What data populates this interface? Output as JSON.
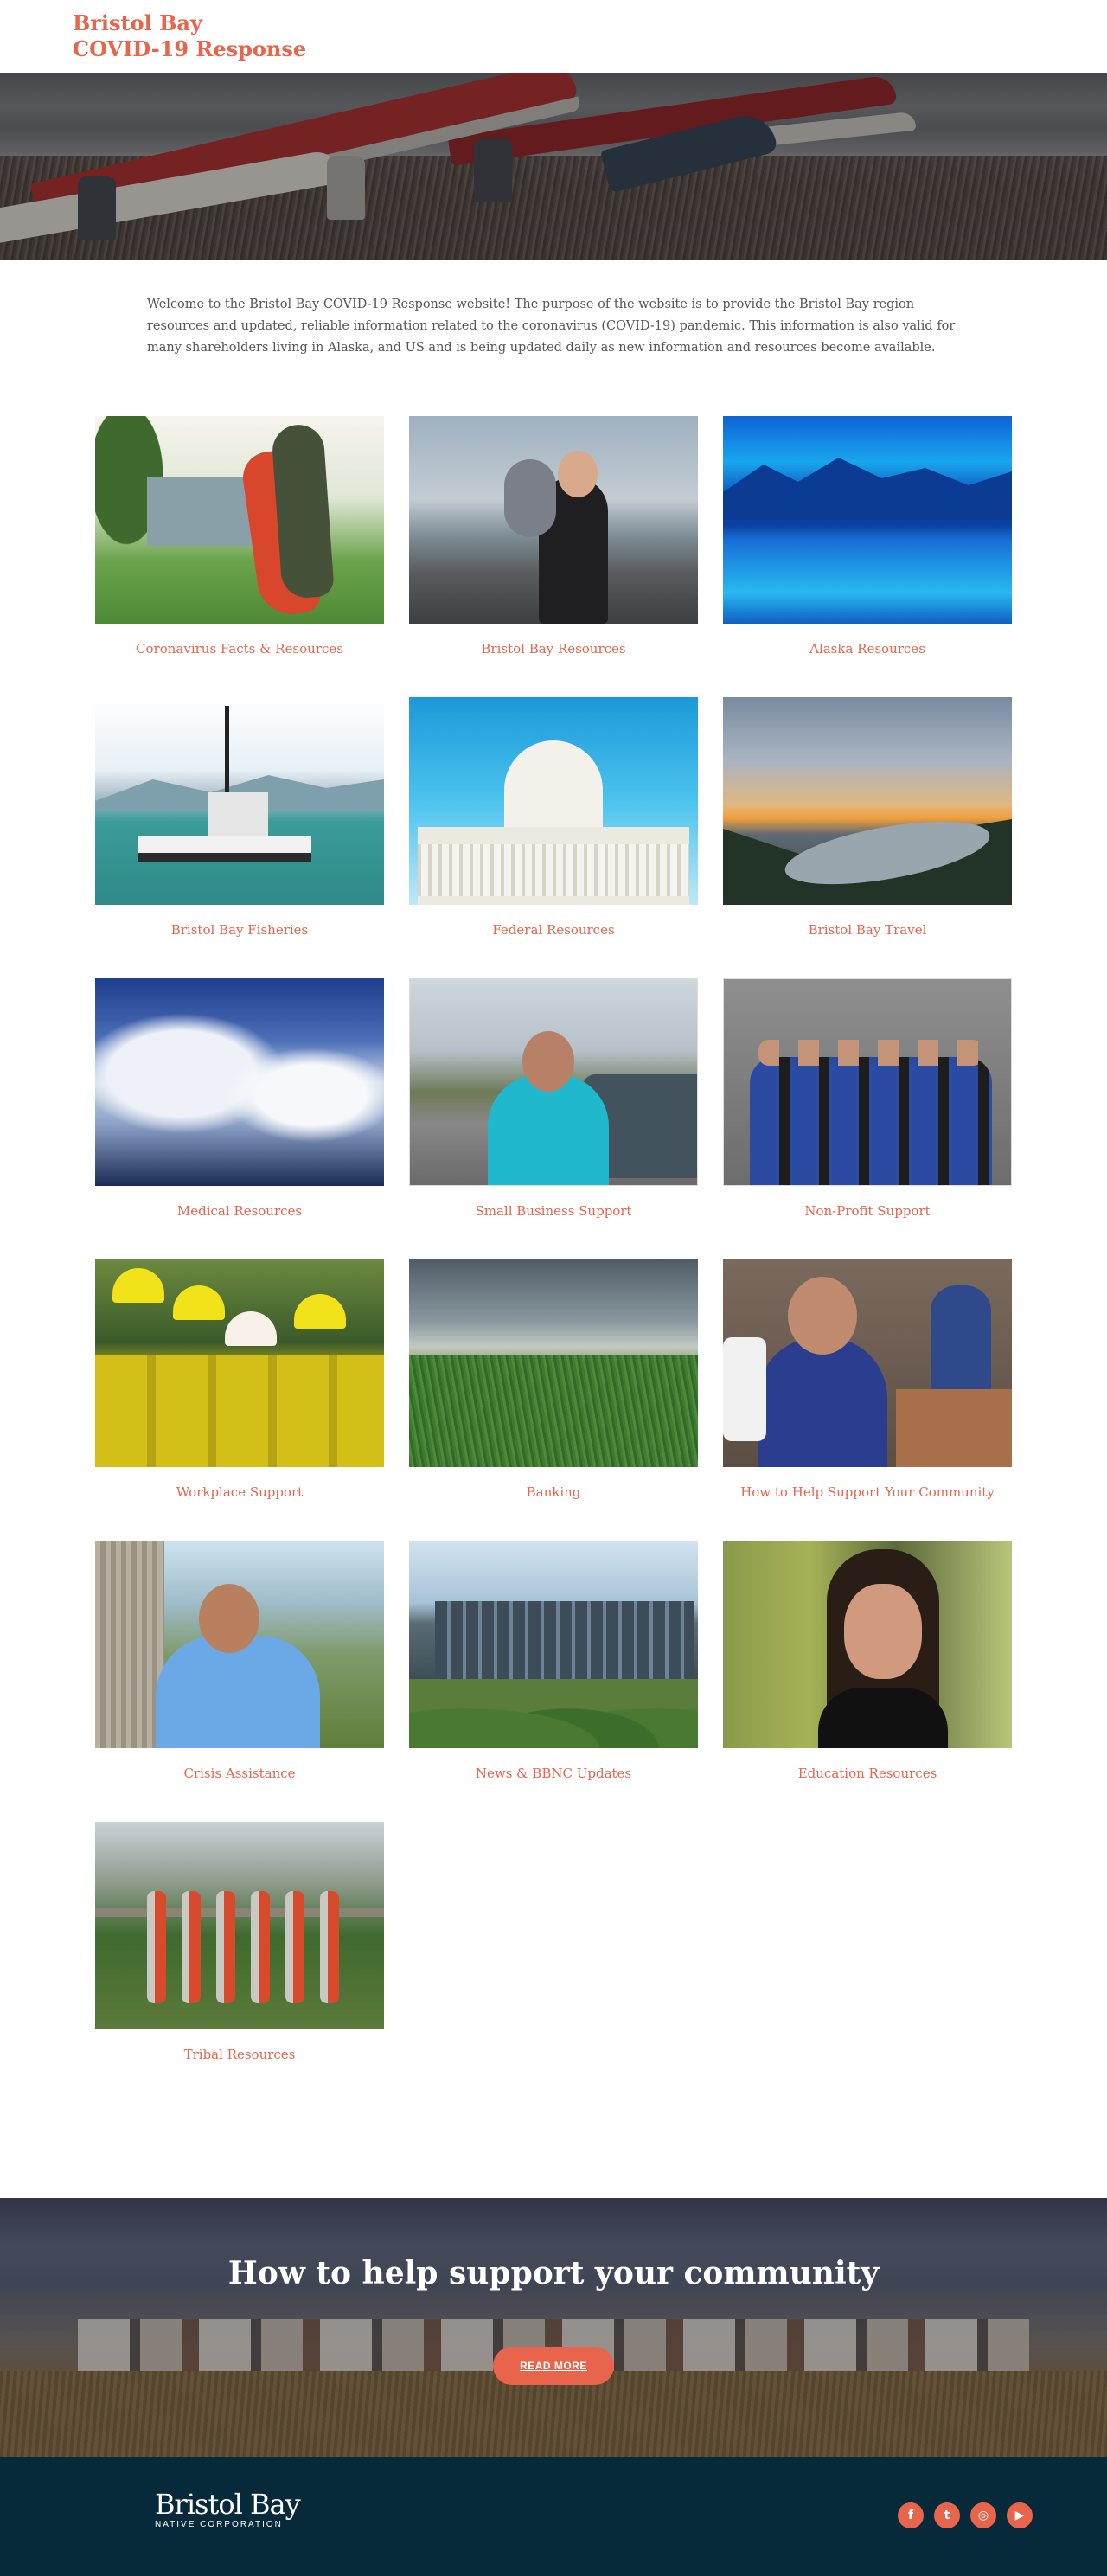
{
  "header": {
    "title_line1": "Bristol Bay",
    "title_line2": "COVID-19 Response"
  },
  "intro": {
    "text": "Welcome to the Bristol Bay COVID-19 Response website! The purpose of the website is to provide the Bristol Bay region resources and updated, reliable information related to the coronavirus (COVID-19) pandemic. This information is also valid for many shareholders living in Alaska, and US and is being updated daily as new information and resources become available."
  },
  "cards": [
    {
      "label": "Coronavirus Facts & Resources"
    },
    {
      "label": "Bristol Bay Resources"
    },
    {
      "label": "Alaska Resources"
    },
    {
      "label": "Bristol Bay Fisheries"
    },
    {
      "label": "Federal Resources"
    },
    {
      "label": "Bristol Bay Travel"
    },
    {
      "label": "Medical Resources"
    },
    {
      "label": "Small Business Support"
    },
    {
      "label": "Non-Profit Support"
    },
    {
      "label": "Workplace Support"
    },
    {
      "label": "Banking"
    },
    {
      "label": "How to Help Support Your Community"
    },
    {
      "label": "Crisis Assistance"
    },
    {
      "label": "News & BBNC Updates"
    },
    {
      "label": "Education Resources"
    },
    {
      "label": "Tribal Resources"
    }
  ],
  "cta": {
    "heading": "How to help support your community",
    "button_label": "READ MORE"
  },
  "footer": {
    "logo_line1": "Bristol Bay",
    "logo_line2": "NATIVE CORPORATION",
    "social": [
      {
        "icon": "facebook-icon",
        "glyph": "f"
      },
      {
        "icon": "twitter-icon",
        "glyph": "t"
      },
      {
        "icon": "instagram-icon",
        "glyph": "◎"
      },
      {
        "icon": "youtube-icon",
        "glyph": "▶"
      }
    ]
  },
  "colors": {
    "accent": "#e8644b",
    "footer_bg": "#062a3a",
    "body_text": "#555555"
  }
}
